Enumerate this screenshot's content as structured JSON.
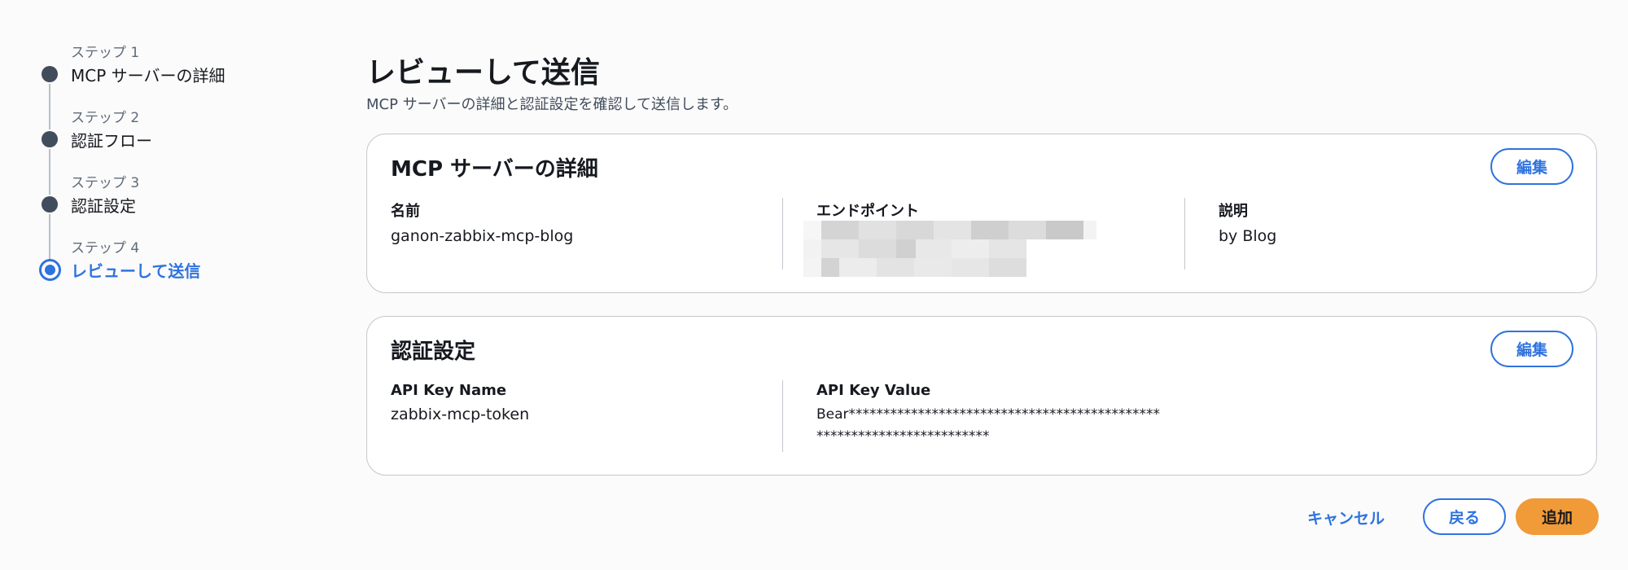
{
  "stepper": {
    "steps": [
      {
        "sub": "ステップ 1",
        "title": "MCP サーバーの詳細"
      },
      {
        "sub": "ステップ 2",
        "title": "認証フロー"
      },
      {
        "sub": "ステップ 3",
        "title": "認証設定"
      },
      {
        "sub": "ステップ 4",
        "title": "レビューして送信"
      }
    ],
    "active_step": 4
  },
  "header": {
    "title": "レビューして送信",
    "description": "MCP サーバーの詳細と認証設定を確認して送信します。"
  },
  "server_card": {
    "title": "MCP サーバーの詳細",
    "edit_label": "編集",
    "name_label": "名前",
    "name_value": "ganon-zabbix-mcp-blog",
    "endpoint_label": "エンドポイント",
    "description_label": "説明",
    "description_value": "by Blog"
  },
  "auth_card": {
    "title": "認証設定",
    "edit_label": "編集",
    "key_name_label": "API Key Name",
    "key_name_value": "zabbix-mcp-token",
    "key_value_label": "API Key Value",
    "key_value_line1": "Bear*********************************************",
    "key_value_line2": "*************************"
  },
  "footer": {
    "cancel_label": "キャンセル",
    "back_label": "戻る",
    "add_label": "追加"
  },
  "colors": {
    "accent": "#2f73df",
    "primary_button": "#f19a38",
    "step_dot": "#414d5c",
    "border": "#c6c6cd"
  }
}
